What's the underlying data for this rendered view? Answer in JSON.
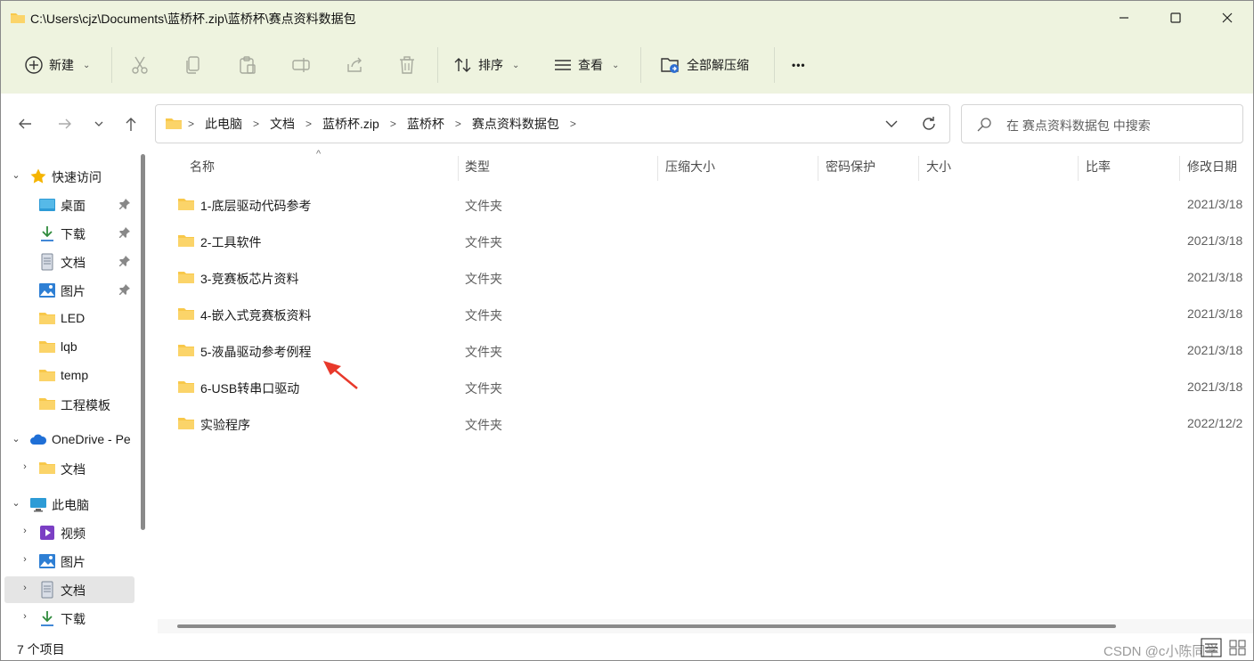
{
  "window": {
    "title": "C:\\Users\\cjz\\Documents\\蓝桥杯.zip\\蓝桥杯\\赛点资料数据包"
  },
  "toolbar": {
    "new_label": "新建",
    "sort_label": "排序",
    "view_label": "查看",
    "extract_all_label": "全部解压缩",
    "more_label": "•••"
  },
  "address": {
    "crumbs": [
      "此电脑",
      "文档",
      "蓝桥杯.zip",
      "蓝桥杯",
      "赛点资料数据包"
    ]
  },
  "search": {
    "placeholder": "在 赛点资料数据包 中搜索"
  },
  "nav": {
    "quick_access": "快速访问",
    "items": [
      {
        "label": "桌面",
        "icon": "desktop-icon",
        "pinned": true
      },
      {
        "label": "下载",
        "icon": "download-icon",
        "pinned": true
      },
      {
        "label": "文档",
        "icon": "document-icon",
        "pinned": true
      },
      {
        "label": "图片",
        "icon": "picture-icon",
        "pinned": true
      },
      {
        "label": "LED",
        "icon": "folder-icon",
        "pinned": false
      },
      {
        "label": "lqb",
        "icon": "folder-icon",
        "pinned": false
      },
      {
        "label": "temp",
        "icon": "folder-icon",
        "pinned": false
      },
      {
        "label": "工程模板",
        "icon": "folder-icon",
        "pinned": false
      }
    ],
    "onedrive": "OneDrive - Pe",
    "onedrive_items": [
      {
        "label": "文档",
        "icon": "folder-icon"
      }
    ],
    "this_pc": "此电脑",
    "pc_items": [
      {
        "label": "视频",
        "icon": "video-icon"
      },
      {
        "label": "图片",
        "icon": "picture-icon"
      },
      {
        "label": "文档",
        "icon": "document-icon",
        "selected": true
      },
      {
        "label": "下载",
        "icon": "download-icon"
      }
    ]
  },
  "columns": [
    "名称",
    "类型",
    "压缩大小",
    "密码保护",
    "大小",
    "比率",
    "修改日期"
  ],
  "files": [
    {
      "name": "1-底层驱动代码参考",
      "type": "文件夹",
      "date": "2021/3/18"
    },
    {
      "name": "2-工具软件",
      "type": "文件夹",
      "date": "2021/3/18"
    },
    {
      "name": "3-竞赛板芯片资料",
      "type": "文件夹",
      "date": "2021/3/18"
    },
    {
      "name": "4-嵌入式竞赛板资料",
      "type": "文件夹",
      "date": "2021/3/18"
    },
    {
      "name": "5-液晶驱动参考例程",
      "type": "文件夹",
      "date": "2021/3/18"
    },
    {
      "name": "6-USB转串口驱动",
      "type": "文件夹",
      "date": "2021/3/18"
    },
    {
      "name": "实验程序",
      "type": "文件夹",
      "date": "2022/12/2"
    }
  ],
  "status": {
    "count": "7 个项目",
    "watermark": "CSDN @c小陈同学"
  },
  "colors": {
    "chrome_bg": "#eef3df",
    "folder_yellow": "#f8c84a",
    "annotation_arrow": "#e8392b",
    "selection_gray": "#e5e5e5"
  }
}
